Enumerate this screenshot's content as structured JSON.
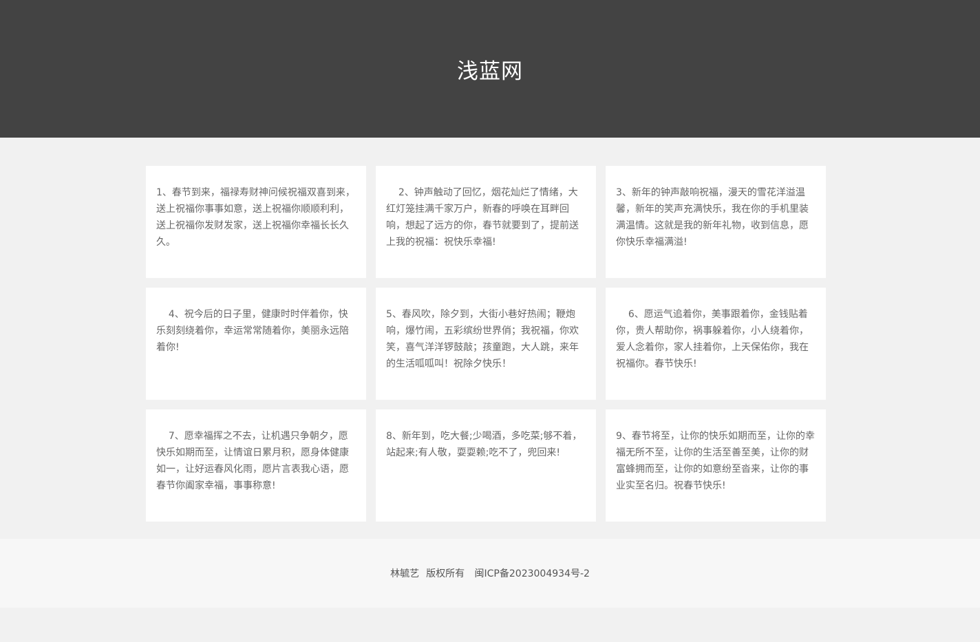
{
  "header": {
    "title": "浅蓝网"
  },
  "cards": [
    "1、春节到来，福禄寿财神问候祝福双喜到来，送上祝福你事事如意，送上祝福你顺顺利利，送上祝福你发财发家，送上祝福你幸福长长久久。",
    "    2、钟声触动了回忆，烟花灿烂了情绪，大红灯笼挂满千家万户，新春的呼唤在耳畔回响，想起了远方的你，春节就要到了，提前送上我的祝福：祝快乐幸福!",
    "3、新年的钟声敲响祝福，漫天的雪花洋溢温馨，新年的笑声充满快乐，我在你的手机里装满温情。这就是我的新年礼物，收到信息，愿你快乐幸福满溢!",
    "    4、祝今后的日子里，健康时时伴着你，快乐刻刻绕着你，幸运常常随着你，美丽永远陪着你!",
    "5、春风吹，除夕到，大街小巷好热闹；鞭炮响，爆竹闹，五彩缤纷世界俏；我祝福，你欢笑，喜气洋洋锣鼓敲；孩童跑，大人跳，来年的生活呱呱叫！祝除夕快乐！",
    "    6、愿运气追着你，美事跟着你，金钱贴着你，贵人帮助你，祸事躲着你，小人绕着你，爱人念着你，家人挂着你，上天保佑你，我在祝福你。春节快乐!",
    "    7、愿幸福挥之不去，让机遇只争朝夕，愿快乐如期而至，让情谊日累月积，愿身体健康如一，让好运春风化雨，愿片言表我心语，愿春节你阖家幸福，事事称意!",
    "8、新年到，吃大餐;少喝酒，多吃菜;够不着，站起来;有人敬，耍耍赖;吃不了，兜回来!",
    "9、春节将至，让你的快乐如期而至，让你的幸福无所不至，让你的生活至善至美，让你的财富蜂拥而至，让你的如意纷至沓来，让你的事业实至名归。祝春节快乐!"
  ],
  "footer": {
    "owner": "林毓艺",
    "rights": "版权所有",
    "icp": "闽ICP备2023004934号-2"
  },
  "colors": {
    "header_bg": "#434343",
    "page_bg": "#f1f1f1",
    "card_bg": "#ffffff",
    "footer_bg": "#f7f7f7"
  }
}
